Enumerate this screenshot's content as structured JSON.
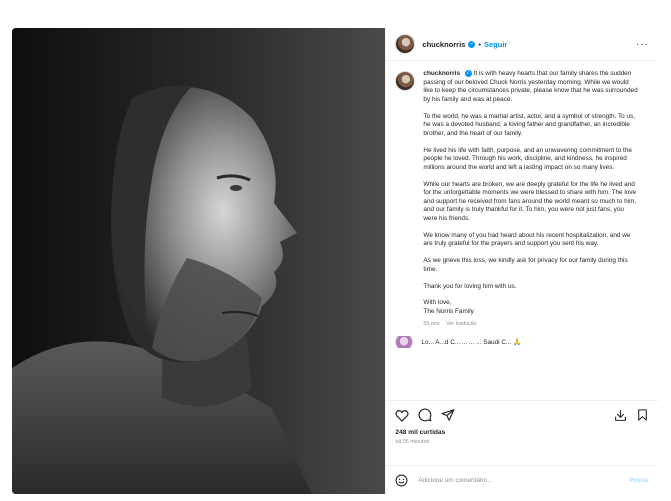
{
  "post": {
    "username": "chucknorris",
    "follow_label": "Seguir",
    "separator": "•",
    "more_label": "···"
  },
  "caption": {
    "username": "chucknorris",
    "paragraphs": [
      "It is with heavy hearts that our family shares the sudden passing of our beloved Chuck Norris yesterday morning. While we would like to keep the circumstances private, please know that he was surrounded by his family and was at peace.",
      "To the world, he was a martial artist, actor, and a symbol of strength. To us, he was a devoted husband, a loving father and grandfather, an incredible brother, and the heart of our family.",
      "He lived his life with faith, purpose, and an unwavering commitment to the people he loved. Through his work, discipline, and kindness, he inspired millions around the world and left a lasting impact on so many lives.",
      "While our hearts are broken, we are deeply grateful for the life he lived and for the unforgettable moments we were blessed to share with him. The love and support he received from fans around the world meant so much to him, and our family is truly thankful for it. To him, you were not just fans, you were his friends.",
      "We know many of you had heard about his recent hospitalization, and we are truly grateful for the prayers and support you sent his way.",
      "As we grieve this loss, we kindly ask for privacy for our family during this time.",
      "Thank you for loving him with us."
    ],
    "sign_off": "With love,",
    "signature": "The Norris Family",
    "age": "55 min",
    "translate_label": "Ver tradução"
  },
  "next_comment": {
    "text": "Lo... A...d C... ... ... ... Saudi C... 🙏"
  },
  "actions": {
    "likes": "248 mil curtidas",
    "time": "há 55 minutos"
  },
  "comment_box": {
    "placeholder": "Adicione um comentário...",
    "post_label": "Postar"
  },
  "icons": {
    "like": "heart-icon",
    "comment": "comment-icon",
    "share": "send-icon",
    "download": "download-icon",
    "save": "bookmark-icon",
    "emoji": "emoji-icon"
  },
  "colors": {
    "accent": "#0095f6",
    "post_disabled": "#b3dbff",
    "muted": "#8e8e8e"
  }
}
